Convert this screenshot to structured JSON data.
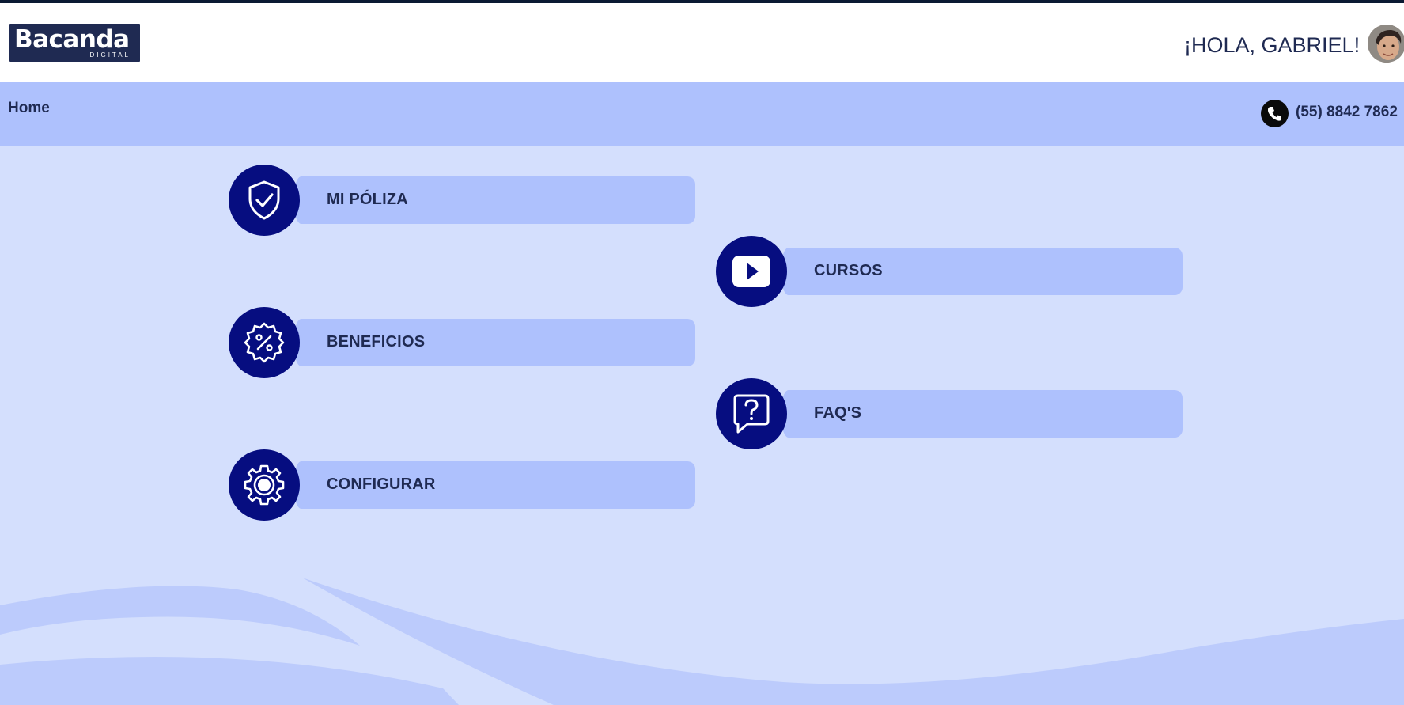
{
  "header": {
    "logo": {
      "word": "Bacanda",
      "sub": "DIGITAL"
    },
    "greeting": "¡HOLA, GABRIEL!",
    "avatar_icon": "user-avatar"
  },
  "navbar": {
    "home_label": "Home",
    "phone_icon": "phone-icon",
    "phone_number": "(55) 8842 7862"
  },
  "menu": [
    {
      "label": "MI PÓLIZA",
      "icon": "shield-check-icon"
    },
    {
      "label": "CURSOS",
      "icon": "play-icon"
    },
    {
      "label": "BENEFICIOS",
      "icon": "percent-badge-icon"
    },
    {
      "label": "FAQ'S",
      "icon": "question-bubble-icon"
    },
    {
      "label": "CONFIGURAR",
      "icon": "gear-icon"
    }
  ],
  "colors": {
    "page_bg": "#d4dffd",
    "bar": "#aec1fd",
    "icon_circle": "#060d80",
    "text": "#1f2a52"
  }
}
